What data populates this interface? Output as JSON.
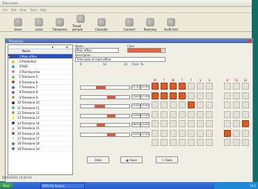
{
  "window": {
    "title": "Time zones"
  },
  "menubar": [
    "File",
    "Edit",
    "View",
    "Tools",
    "Help"
  ],
  "toolbar": [
    {
      "label": "Users",
      "icon": "users-icon"
    },
    {
      "label": "Locks",
      "icon": "lock-icon"
    },
    {
      "label": "Timezones",
      "icon": "clock-icon"
    },
    {
      "label": "Timed periods",
      "icon": "calendar-icon"
    },
    {
      "label": "Calendar",
      "icon": "calendar-grid-icon"
    },
    {
      "label": "Connect",
      "icon": "connect-icon"
    },
    {
      "label": "Read key",
      "icon": "key-icon"
    },
    {
      "label": "Audit trail",
      "icon": "audit-icon"
    }
  ],
  "child_title": "Timezones",
  "list": {
    "column_name": "Name",
    "rows": [
      {
        "num": "1",
        "name": "Main office",
        "color": "#7b4f2a",
        "selected": true
      },
      {
        "num": "2",
        "name": "Production",
        "color": "#f0c000"
      },
      {
        "num": "3",
        "name": "R&D",
        "color": "#3aa0e8"
      },
      {
        "num": "4",
        "name": "Training area",
        "color": "#e86d9a"
      },
      {
        "num": "5",
        "name": "Timezone 5",
        "color": "#7bbf3a"
      },
      {
        "num": "6",
        "name": "Timezone 6",
        "color": "#d02a2a"
      },
      {
        "num": "7",
        "name": "Timezone 7",
        "color": "#3a6fd0"
      },
      {
        "num": "8",
        "name": "Timezone 8",
        "color": "#9a3ad0"
      },
      {
        "num": "9",
        "name": "Timezone 9",
        "color": "#f08a20"
      },
      {
        "num": "10",
        "name": "Timezone 10",
        "color": "#2a2a2a"
      },
      {
        "num": "11",
        "name": "Timezone 11",
        "color": "#40c0a0"
      },
      {
        "num": "12",
        "name": "Timezone 12",
        "color": "#a0a020"
      },
      {
        "num": "13",
        "name": "Timezone 13",
        "color": "#f0f030"
      },
      {
        "num": "14",
        "name": "Timezone 14",
        "color": "#1a3a8a"
      },
      {
        "num": "15",
        "name": "Timezone 15",
        "color": "#c0c0c0"
      },
      {
        "num": "16",
        "name": "Timezone 16",
        "color": "#a04040"
      },
      {
        "num": "17",
        "name": "Timezone 17",
        "color": "#e0e0e0"
      },
      {
        "num": "18",
        "name": "Timezone 18",
        "color": "#2a9a2a"
      },
      {
        "num": "19",
        "name": "Timezone 19",
        "color": "#6a6a6a"
      }
    ]
  },
  "form": {
    "name_label": "Name",
    "name_value": "Main office",
    "color_label": "Color",
    "color_value": "#e8603a",
    "desc_label": "Description",
    "desc_value": "Time zone of main office"
  },
  "timeline": {
    "h0": "0",
    "h12": "12",
    "h24": "24",
    "from": "From",
    "to": "To"
  },
  "periods": [
    {
      "from": "07:30",
      "to": "12:30"
    },
    {
      "from": "13:00",
      "to": "17:00"
    },
    {
      "from": "07:00",
      "to": "12:00"
    },
    {
      "from": "13:00",
      "to": "17:00"
    },
    {
      "from": "08:00",
      "to": "12:00"
    },
    {
      "from": "13:00",
      "to": "17:00"
    }
  ],
  "days": [
    "M",
    "T",
    "W",
    "T",
    "F",
    "S",
    "S",
    "",
    "H",
    "S1",
    "S2"
  ],
  "grid_on": [
    [
      0,
      1,
      2,
      3
    ],
    [
      0,
      1,
      2,
      3
    ],
    [
      4
    ],
    [],
    [
      10
    ],
    [
      8
    ],
    [
      11
    ]
  ],
  "buttons": {
    "clear": "Clear",
    "save": "Save",
    "close": "Close"
  },
  "status": "20/03/2011 14:20:54",
  "taskbar": {
    "start": "Start",
    "task": "SOFI Pro Access",
    "clock": "14:1"
  }
}
